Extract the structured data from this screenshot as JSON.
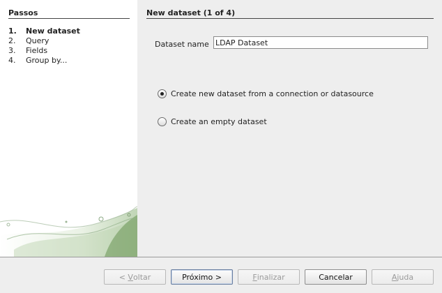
{
  "steps": {
    "title": "Passos",
    "items": [
      {
        "num": "1.",
        "label": "New dataset"
      },
      {
        "num": "2.",
        "label": "Query"
      },
      {
        "num": "3.",
        "label": "Fields"
      },
      {
        "num": "4.",
        "label": "Group by..."
      }
    ]
  },
  "page": {
    "title": "New dataset (1 of 4)",
    "dataset_name_label": "Dataset name",
    "dataset_name_value": "LDAP Dataset",
    "options": [
      {
        "label": "Create new dataset from a connection or datasource",
        "selected": true
      },
      {
        "label": "Create an empty dataset",
        "selected": false
      }
    ]
  },
  "buttons": {
    "back": {
      "prefix": "< ",
      "mnemonic": "V",
      "rest": "oltar"
    },
    "next": {
      "label": "Próximo >"
    },
    "finish": {
      "mnemonic": "F",
      "rest": "inalizar"
    },
    "cancel": {
      "label": "Cancelar"
    },
    "help": {
      "mnemonic": "A",
      "rest": "juda"
    }
  }
}
